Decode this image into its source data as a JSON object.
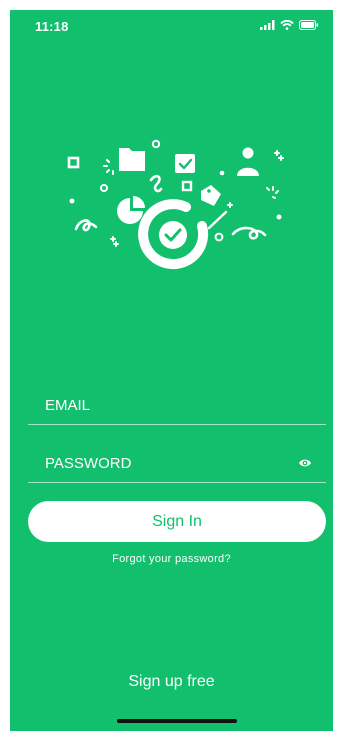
{
  "status_bar": {
    "time": "11:18",
    "icons": [
      "signal-icon",
      "wifi-icon",
      "battery-icon"
    ]
  },
  "illustration": {
    "logo_icon": "check-circle-logo-icon",
    "decor_icons": [
      "folder-icon",
      "checkbox-icon",
      "user-icon",
      "pie-chart-icon",
      "tag-icon",
      "pencil-icon",
      "sparkle-icon",
      "spinner-icon",
      "confetti-icon"
    ]
  },
  "form": {
    "email_placeholder": "EMAIL",
    "email_value": "",
    "password_placeholder": "PASSWORD",
    "password_value": "",
    "show_password_icon": "eye-icon",
    "signin_label": "Sign In",
    "forgot_label": "Forgot your password?"
  },
  "footer": {
    "signup_label": "Sign up free"
  },
  "colors": {
    "background": "#12bf6d",
    "foreground": "#ffffff",
    "button_text": "#12bf6d"
  }
}
